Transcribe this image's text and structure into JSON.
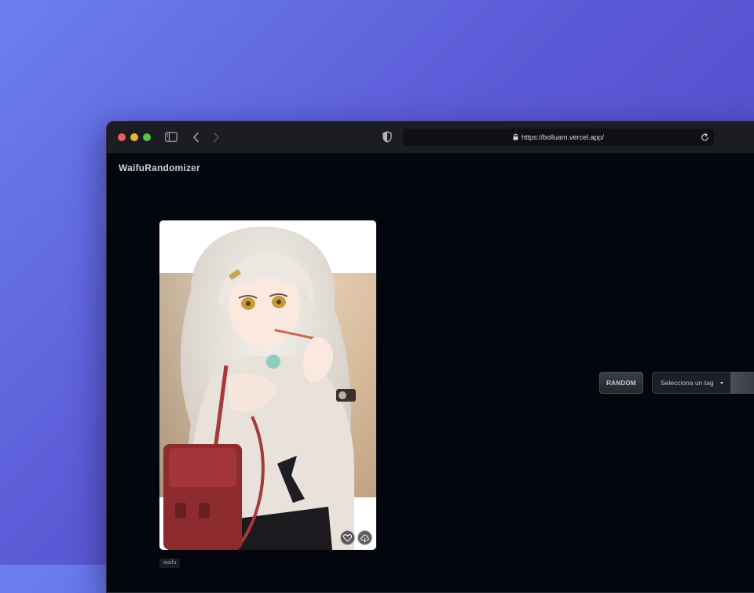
{
  "browser": {
    "url": "https://bolluam.vercel.app/",
    "icons": [
      "sidebar-icon",
      "back-icon",
      "forward-icon",
      "shield-icon",
      "lock-icon",
      "reload-icon"
    ]
  },
  "app": {
    "title": "WaifuRandomizer"
  },
  "controls": {
    "random_label": "RANDOM",
    "tag_select_value": "Selecciona un tag"
  },
  "card": {
    "tag": "waifu",
    "icons": [
      "heart-icon",
      "download-icon"
    ]
  },
  "colors": {
    "background_gradient_start": "#6b7ff0",
    "background_gradient_end": "#5044c4",
    "app_background": "#03060d",
    "toolbar": "#1c1d21"
  }
}
